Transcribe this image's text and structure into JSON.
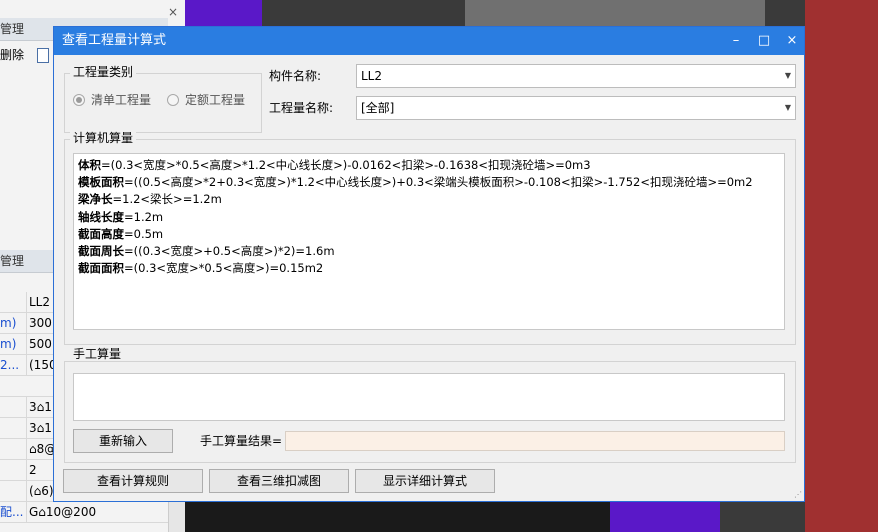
{
  "background": {
    "panel_top_header": "管理",
    "panel_top_close": "×",
    "toolbar_delete": "删除",
    "panel_mid_header": "管理",
    "properties": [
      {
        "k": "",
        "v": "LL2"
      },
      {
        "k": "m)",
        "v": "300"
      },
      {
        "k": "m)",
        "v": "500"
      },
      {
        "k": "2...",
        "v": "(150"
      },
      {
        "k": "",
        "v": ""
      },
      {
        "k": "",
        "v": "3⌂1"
      },
      {
        "k": "",
        "v": "3⌂1"
      },
      {
        "k": "",
        "v": "⌂8@"
      },
      {
        "k": "",
        "v": "2"
      },
      {
        "k": "",
        "v": "(⌂6)"
      },
      {
        "k": "配...",
        "v": "G⌂10@200"
      }
    ]
  },
  "dialog": {
    "title": "查看工程量计算式",
    "min_icon": "–",
    "max_icon": "□",
    "close_icon": "×",
    "quantity_type": {
      "legend": "工程量类别",
      "option_list": "清单工程量",
      "option_quota": "定额工程量",
      "selected": "清单工程量"
    },
    "component_name_label": "构件名称:",
    "component_name_value": "LL2",
    "quantity_name_label": "工程量名称:",
    "quantity_name_value": "[全部]",
    "computer_calc": {
      "legend": "计算机算量",
      "lines": [
        {
          "name": "体积",
          "expr": "=(0.3<宽度>*0.5<高度>*1.2<中心线长度>)-0.0162<扣梁>-0.1638<扣现浇砼墙>=0m3"
        },
        {
          "name": "模板面积",
          "expr": "=((0.5<高度>*2+0.3<宽度>)*1.2<中心线长度>)+0.3<梁端头模板面积>-0.108<扣梁>-1.752<扣现浇砼墙>=0m2"
        },
        {
          "name": "梁净长",
          "expr": "=1.2<梁长>=1.2m"
        },
        {
          "name": "轴线长度",
          "expr": "=1.2m"
        },
        {
          "name": "截面高度",
          "expr": "=0.5m"
        },
        {
          "name": "截面周长",
          "expr": "=((0.3<宽度>+0.5<高度>)*2)=1.6m"
        },
        {
          "name": "截面面积",
          "expr": "=(0.3<宽度>*0.5<高度>)=0.15m2"
        }
      ]
    },
    "manual_calc": {
      "legend": "手工算量",
      "reinput_button": "重新输入",
      "result_label": "手工算量结果=",
      "result_value": ""
    },
    "buttons": {
      "view_rules": "查看计算规则",
      "view_3d": "查看三维扣减图",
      "show_detail": "显示详细计算式"
    }
  }
}
